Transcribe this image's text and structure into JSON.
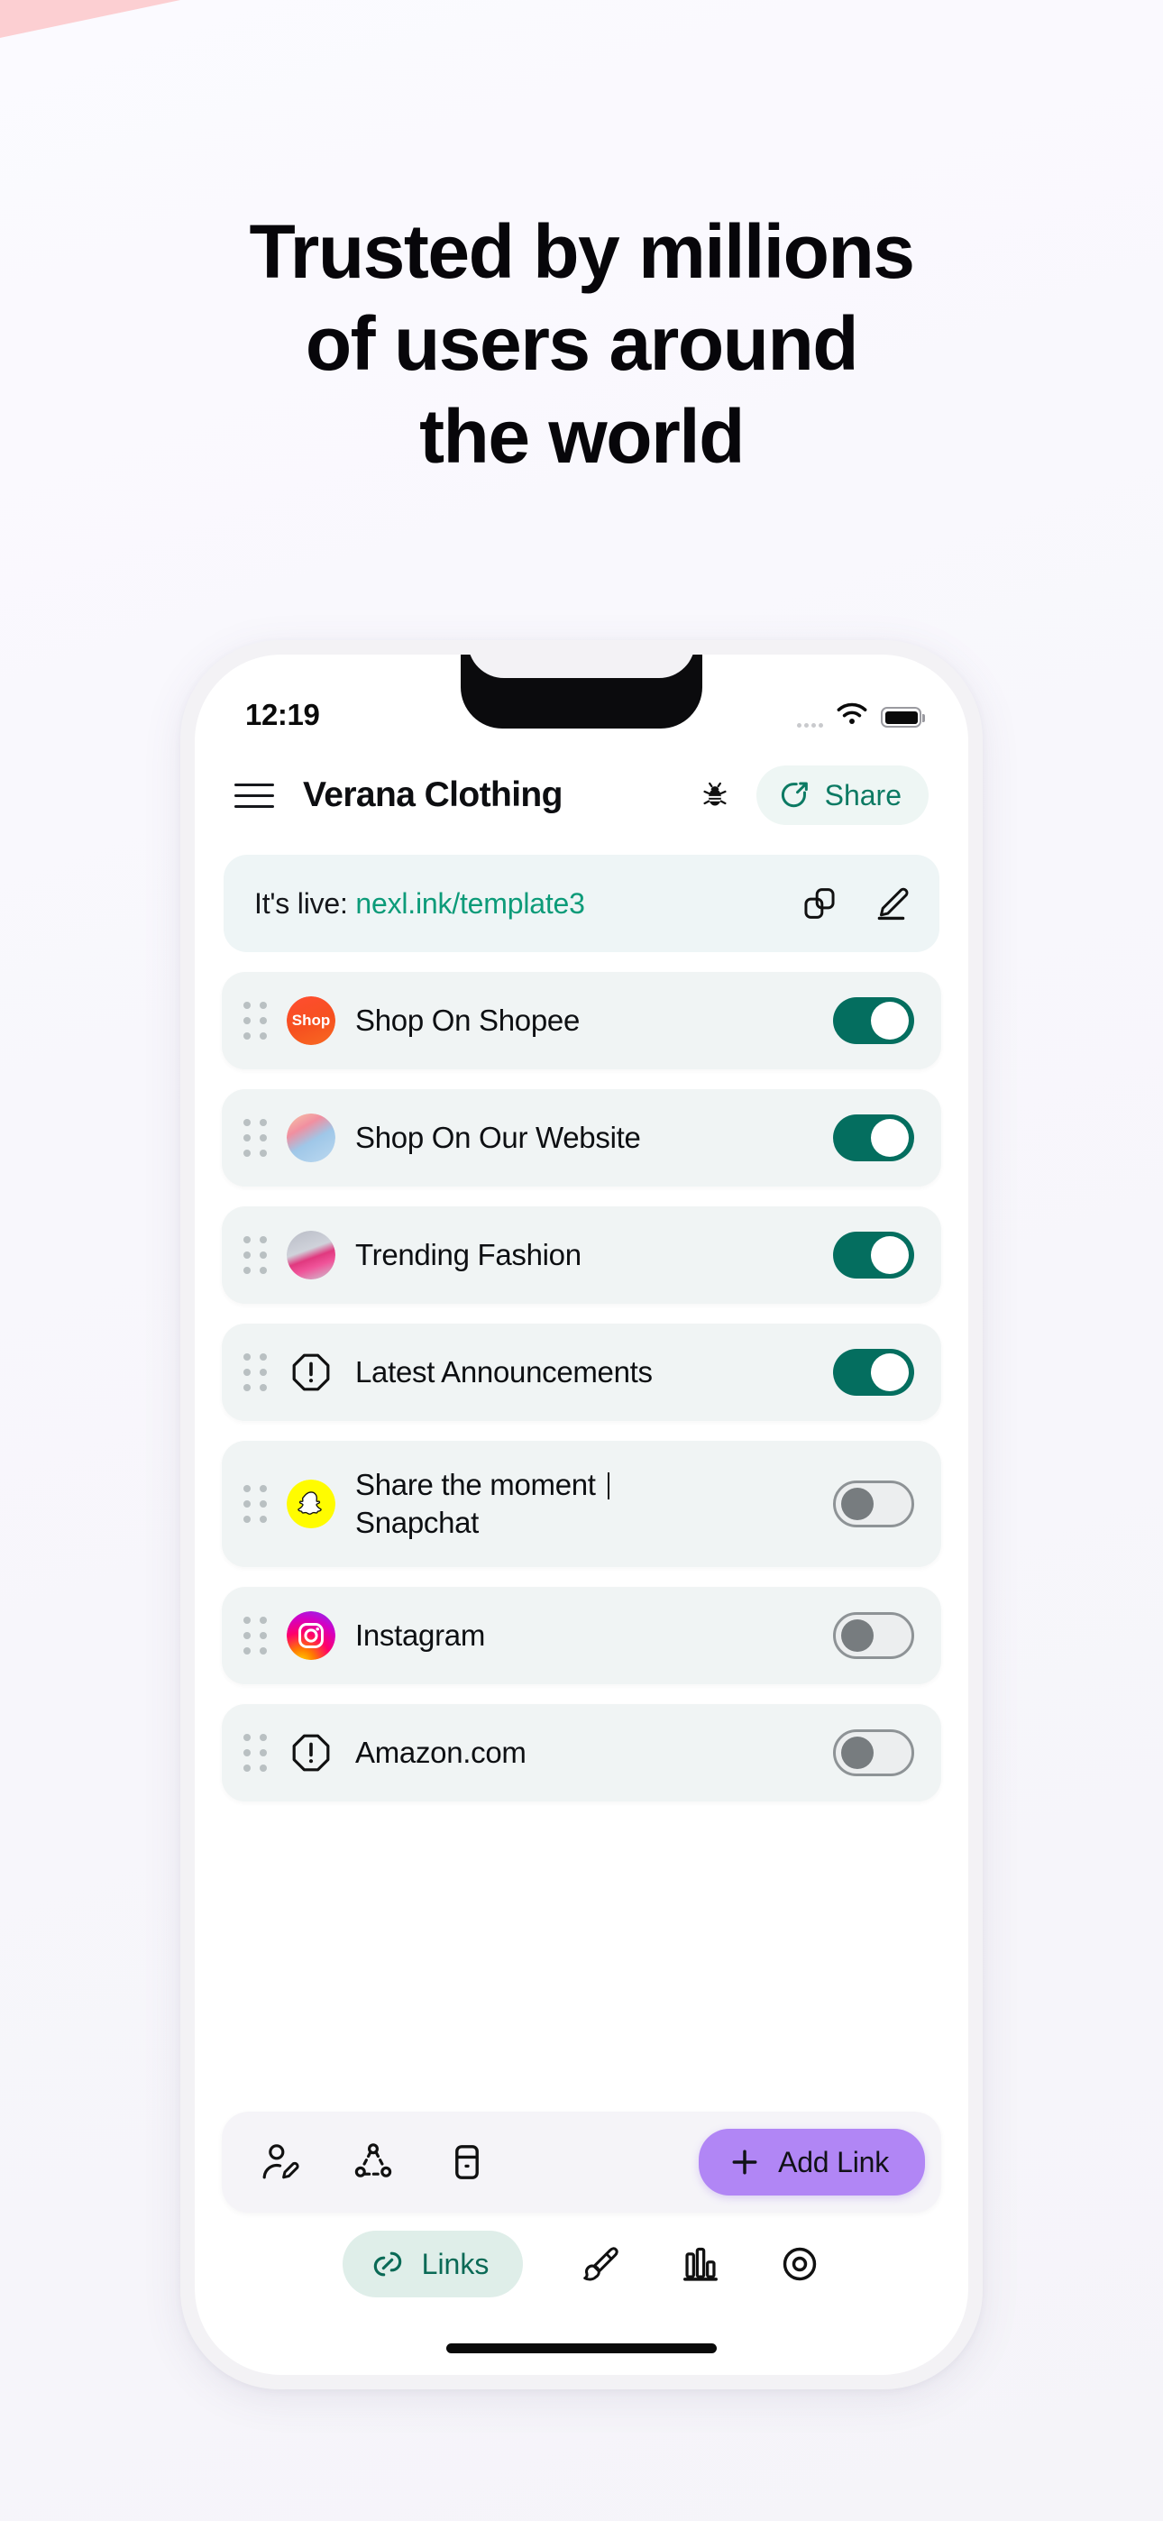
{
  "page": {
    "headline_lines": [
      "Trusted by millions",
      "of users around",
      "the world"
    ],
    "accent_pink": "#fccfd2",
    "accent_teal": "#046e5f",
    "accent_purple": "#b186f5"
  },
  "status_bar": {
    "time": "12:19",
    "signal_icon": "signal-dots-icon",
    "wifi_icon": "wifi-icon",
    "battery_icon": "battery-full-icon"
  },
  "app_header": {
    "menu_icon": "hamburger-menu-icon",
    "title": "Verana Clothing",
    "bug_icon": "bug-icon",
    "share_label": "Share",
    "share_icon": "share-arrow-icon"
  },
  "live_banner": {
    "prefix": "It's live: ",
    "url": "nexl.ink/template3",
    "copy_icon": "copy-icon",
    "edit_icon": "edit-pencil-icon"
  },
  "links": [
    {
      "label": "Shop On Shopee",
      "icon": "shopee-icon",
      "icon_text": "Shop",
      "enabled": true
    },
    {
      "label": "Shop On Our Website",
      "icon": "website-photo-icon",
      "icon_text": "",
      "enabled": true
    },
    {
      "label": "Trending Fashion",
      "icon": "fashion-photo-icon",
      "icon_text": "",
      "enabled": true
    },
    {
      "label": "Latest Announcements",
      "icon": "alert-octagon-icon",
      "icon_text": "",
      "enabled": true
    },
    {
      "label": "Share the moment | Snapchat",
      "icon": "snapchat-icon",
      "icon_text": "",
      "enabled": false,
      "two_line": true,
      "line1": "Share the moment ",
      "line2": "Snapchat"
    },
    {
      "label": "Instagram",
      "icon": "instagram-icon",
      "icon_text": "",
      "enabled": false
    },
    {
      "label": "Amazon.com",
      "icon": "alert-octagon-icon",
      "icon_text": "",
      "enabled": false
    }
  ],
  "toolbar": {
    "profile_icon": "edit-profile-icon",
    "network_icon": "share-network-icon",
    "archive_icon": "archive-icon",
    "add_link_label": "Add Link",
    "add_link_icon": "plus-icon"
  },
  "bottom_nav": {
    "links_label": "Links",
    "links_icon": "links-chain-icon",
    "design_icon": "design-brush-icon",
    "analytics_icon": "bar-chart-icon",
    "preview_icon": "eye-preview-icon"
  }
}
